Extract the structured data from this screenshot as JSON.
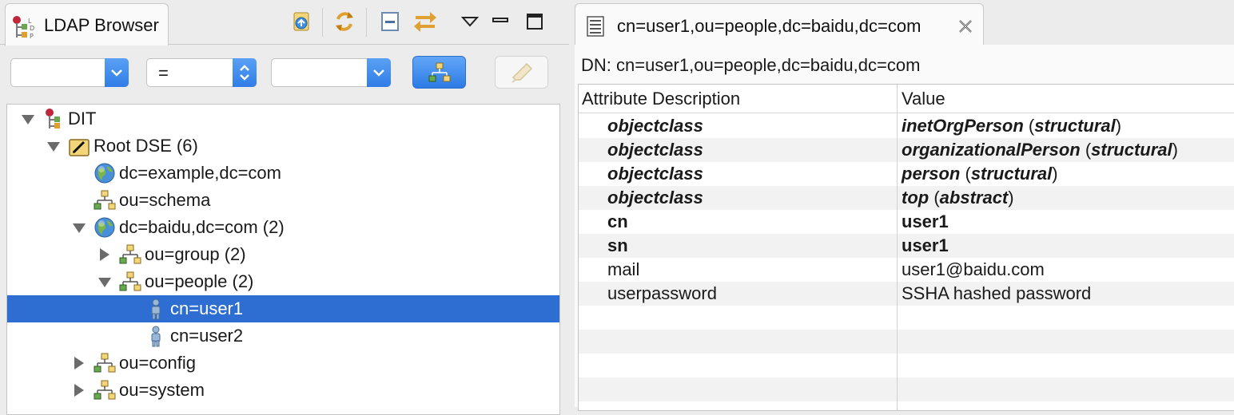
{
  "left_view": {
    "tab_title": "LDAP Browser",
    "filter": {
      "attribute_value": "",
      "operator_value": "=",
      "value_value": ""
    },
    "tree": [
      {
        "label": "DIT",
        "level": 0,
        "expanded": true,
        "icon": "dit-icon"
      },
      {
        "label": "Root DSE (6)",
        "level": 1,
        "expanded": true,
        "icon": "root-dse-icon"
      },
      {
        "label": "dc=example,dc=com",
        "level": 2,
        "expanded": null,
        "icon": "globe-icon"
      },
      {
        "label": "ou=schema",
        "level": 2,
        "expanded": null,
        "icon": "ou-icon"
      },
      {
        "label": "dc=baidu,dc=com (2)",
        "level": 2,
        "expanded": true,
        "icon": "globe-icon"
      },
      {
        "label": "ou=group (2)",
        "level": 3,
        "expanded": false,
        "icon": "ou-icon"
      },
      {
        "label": "ou=people (2)",
        "level": 3,
        "expanded": true,
        "icon": "ou-icon"
      },
      {
        "label": "cn=user1",
        "level": 4,
        "expanded": null,
        "icon": "person-icon",
        "selected": true
      },
      {
        "label": "cn=user2",
        "level": 4,
        "expanded": null,
        "icon": "person-icon"
      },
      {
        "label": "ou=config",
        "level": 2,
        "expanded": false,
        "icon": "ou-icon"
      },
      {
        "label": "ou=system",
        "level": 2,
        "expanded": false,
        "icon": "ou-icon"
      }
    ]
  },
  "editor": {
    "tab_title": "cn=user1,ou=people,dc=baidu,dc=com",
    "dn_label": "DN: cn=user1,ou=people,dc=baidu,dc=com",
    "columns": [
      "Attribute Description",
      "Value"
    ],
    "rows": [
      {
        "attr": "objectclass",
        "value": "inetOrgPerson",
        "suffix_open": " (",
        "suffix_word": "structural",
        "suffix_close": ")",
        "style": "objectclass"
      },
      {
        "attr": "objectclass",
        "value": "organizationalPerson",
        "suffix_open": " (",
        "suffix_word": "structural",
        "suffix_close": ")",
        "style": "objectclass"
      },
      {
        "attr": "objectclass",
        "value": "person",
        "suffix_open": " (",
        "suffix_word": "structural",
        "suffix_close": ")",
        "style": "objectclass"
      },
      {
        "attr": "objectclass",
        "value": "top",
        "suffix_open": " (",
        "suffix_word": "abstract",
        "suffix_close": ")",
        "style": "objectclass"
      },
      {
        "attr": "cn",
        "value": "user1",
        "style": "must"
      },
      {
        "attr": "sn",
        "value": "user1",
        "style": "must"
      },
      {
        "attr": "mail",
        "value": "user1@baidu.com",
        "style": "may"
      },
      {
        "attr": "userpassword",
        "value": "SSHA hashed password",
        "style": "may"
      }
    ]
  },
  "colors": {
    "selection": "#2e6dd2",
    "accent_blue": "#2f7de6"
  }
}
